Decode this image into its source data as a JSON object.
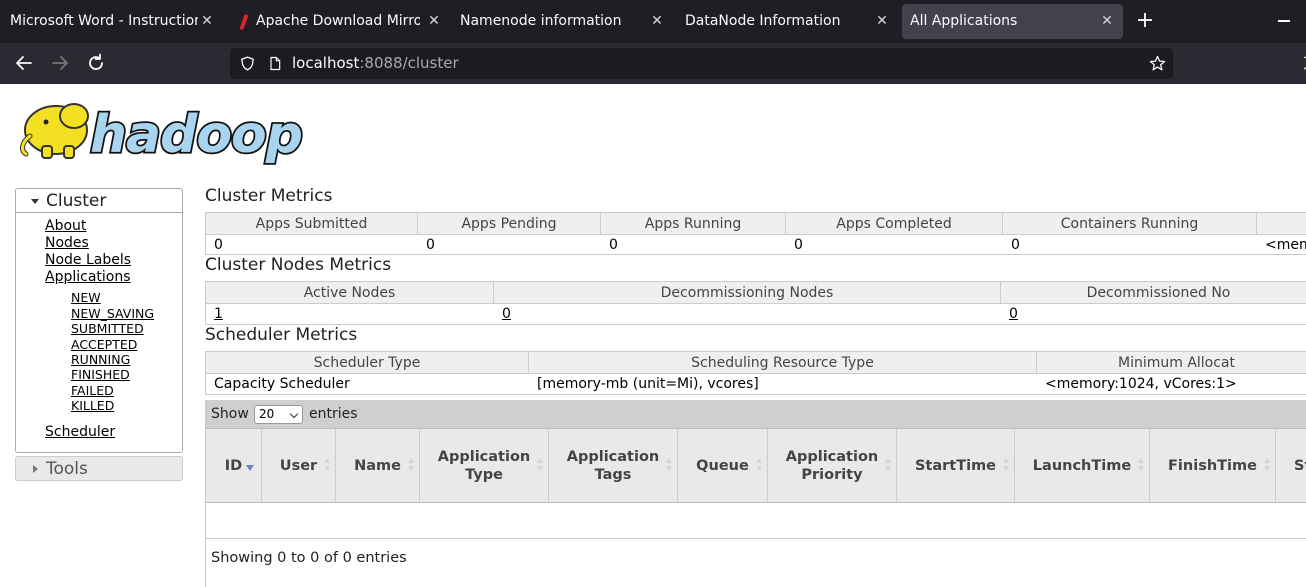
{
  "browser": {
    "tabs": [
      {
        "title": "Microsoft Word - Instructions",
        "active": false
      },
      {
        "title": "Apache Download Mirrors",
        "active": false
      },
      {
        "title": "Namenode information",
        "active": false
      },
      {
        "title": "DataNode Information",
        "active": false
      },
      {
        "title": "All Applications",
        "active": true
      }
    ],
    "url_host": "localhost",
    "url_rest": ":8088/cluster"
  },
  "logo": {
    "text": "hadoop"
  },
  "sidebar": {
    "cluster_title": "Cluster",
    "links": [
      "About",
      "Nodes",
      "Node Labels",
      "Applications"
    ],
    "app_states": [
      "NEW",
      "NEW_SAVING",
      "SUBMITTED",
      "ACCEPTED",
      "RUNNING",
      "FINISHED",
      "FAILED",
      "KILLED"
    ],
    "scheduler_link": "Scheduler",
    "tools_title": "Tools"
  },
  "cluster_metrics": {
    "title": "Cluster Metrics",
    "headers": [
      "Apps Submitted",
      "Apps Pending",
      "Apps Running",
      "Apps Completed",
      "Containers Running",
      ""
    ],
    "values": [
      "0",
      "0",
      "0",
      "0",
      "0",
      "<mem"
    ]
  },
  "nodes_metrics": {
    "title": "Cluster Nodes Metrics",
    "headers": [
      "Active Nodes",
      "Decommissioning Nodes",
      "Decommissioned No"
    ],
    "values": [
      "1",
      "0",
      "0"
    ]
  },
  "scheduler_metrics": {
    "title": "Scheduler Metrics",
    "headers": [
      "Scheduler Type",
      "Scheduling Resource Type",
      "Minimum Allocat"
    ],
    "values": [
      "Capacity Scheduler",
      "[memory-mb (unit=Mi), vcores]",
      "<memory:1024, vCores:1>"
    ]
  },
  "apps_table": {
    "show_label": "Show",
    "page_size": "20",
    "entries_label": "entries",
    "columns": [
      "ID",
      "User",
      "Name",
      "Application Type",
      "Application Tags",
      "Queue",
      "Application Priority",
      "StartTime",
      "LaunchTime",
      "FinishTime",
      "St"
    ],
    "footer": "Showing 0 to 0 of 0 entries"
  }
}
